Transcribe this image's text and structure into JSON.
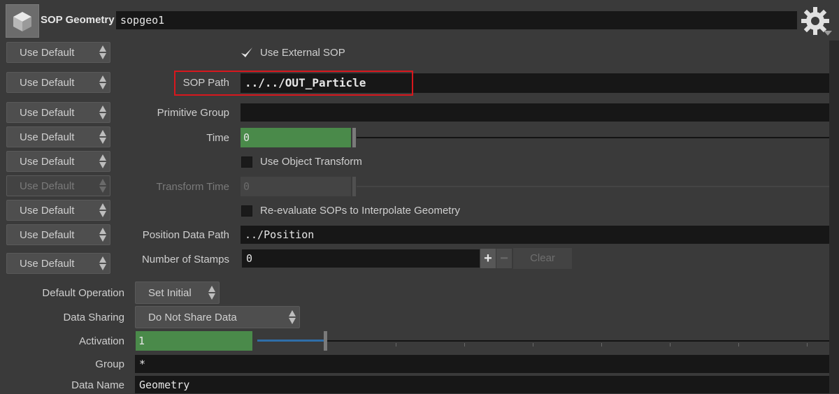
{
  "header": {
    "node_type": "SOP Geometry",
    "node_name": "sopgeo1",
    "icons": {
      "node": "cube-icon",
      "settings": "gear-icon"
    }
  },
  "use_default_label": "Use Default",
  "params": {
    "use_external_sop": {
      "label": "Use External SOP",
      "checked": true
    },
    "sop_path": {
      "label": "SOP Path",
      "value": "../../OUT_Particle"
    },
    "primitive_group": {
      "label": "Primitive Group",
      "value": ""
    },
    "time": {
      "label": "Time",
      "value": "0"
    },
    "use_object_transform": {
      "label": "Use Object Transform",
      "checked": false
    },
    "transform_time": {
      "label": "Transform Time",
      "value": "0"
    },
    "reevaluate": {
      "label": "Re-evaluate SOPs to Interpolate Geometry",
      "checked": false
    },
    "position_data_path": {
      "label": "Position Data Path",
      "value": "../Position"
    },
    "number_of_stamps": {
      "label": "Number of Stamps",
      "value": "0",
      "plus": "+",
      "minus": "−",
      "clear": "Clear"
    },
    "default_operation": {
      "label": "Default Operation",
      "value": "Set Initial"
    },
    "data_sharing": {
      "label": "Data Sharing",
      "value": "Do Not Share Data"
    },
    "activation": {
      "label": "Activation",
      "value": "1"
    },
    "group": {
      "label": "Group",
      "value": "*"
    },
    "data_name": {
      "label": "Data Name",
      "value": "Geometry"
    }
  },
  "colors": {
    "highlight": "#d8171d",
    "slider_fill": "#4a8a4a",
    "field_bg": "#171717",
    "panel_bg": "#3a3a3a"
  }
}
